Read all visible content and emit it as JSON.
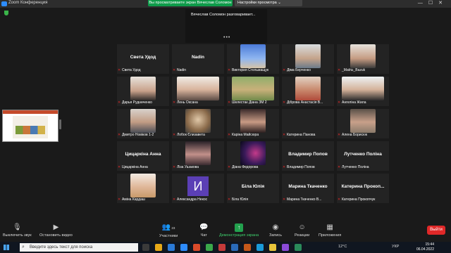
{
  "window": {
    "title": "Zoom Конференция"
  },
  "banner": {
    "sharing_text": "Вы просматриваете экран Вячеслав Соломон",
    "view_options": "Настройки просмотра ⌄"
  },
  "speaking": {
    "text": "Вячеслав Соломон разговаривает...",
    "more": "•••"
  },
  "tiles": [
    {
      "big": "Света Удод",
      "label": "Света Удод"
    },
    {
      "big": "Nadin",
      "label": "Nadin"
    },
    {
      "label": "Виктория Стельмащук"
    },
    {
      "label": "Діма Берченко"
    },
    {
      "label": "_Mat№_Bazuk"
    },
    {
      "label": "Дарья Рудниченко"
    },
    {
      "label": "Лень Оксана"
    },
    {
      "label": "Шелестак Діана ЗМ 2"
    },
    {
      "label": "Діброва Анастасія В..."
    },
    {
      "label": "Ангеліна Жила"
    },
    {
      "label": "Дмитро Новіков 1-2"
    },
    {
      "label": "Лобок Єлизавета"
    },
    {
      "label": "Каріна Майсюра"
    },
    {
      "label": "Катерина Панова"
    },
    {
      "label": "Алена Борисюк"
    },
    {
      "big": "Цицаркіна Анна",
      "label": "Цицаркіна Анна"
    },
    {
      "label": "Ліза Ушакова"
    },
    {
      "label": "Діана Федорова"
    },
    {
      "big": "Владимир Попов",
      "label": "Владимир Попов"
    },
    {
      "big": "Лутченко Поліна",
      "label": "Лутченко Поліна"
    },
    {
      "label": "Аміна Кардаш"
    },
    {
      "avatar": "И",
      "label": "Александра Некос"
    },
    {
      "big": "Біла Юлія",
      "label": "Біла Юлія"
    },
    {
      "big": "Марина Ткаченко",
      "label": "Марина Ткаченко В..."
    },
    {
      "big": "Катерина Прокоп...",
      "label": "Катерина Прокопчук"
    }
  ],
  "toolbar": {
    "mute": "Выключить звук",
    "video": "Остановить видео",
    "participants": "Участники",
    "participants_count": "23",
    "chat": "Чат",
    "share": "Демонстрация экрана",
    "record": "Запись",
    "reactions": "Реакции",
    "apps": "Приложения",
    "leave": "Выйти"
  },
  "taskbar": {
    "search_placeholder": "Введите здесь текст для поиска",
    "weather": "12°C",
    "lang": "УКР",
    "time": "15:44",
    "date": "06.04.2022"
  },
  "colors": {
    "accent_green": "#0e9b4a",
    "leave_red": "#e02828",
    "avatar_purple": "#5b3fb5"
  },
  "icons": [
    "shield-icon",
    "mic-icon",
    "video-icon",
    "participants-icon",
    "chat-icon",
    "share-screen-icon",
    "record-icon",
    "reactions-icon",
    "apps-icon",
    "windows-start-icon",
    "search-icon"
  ]
}
